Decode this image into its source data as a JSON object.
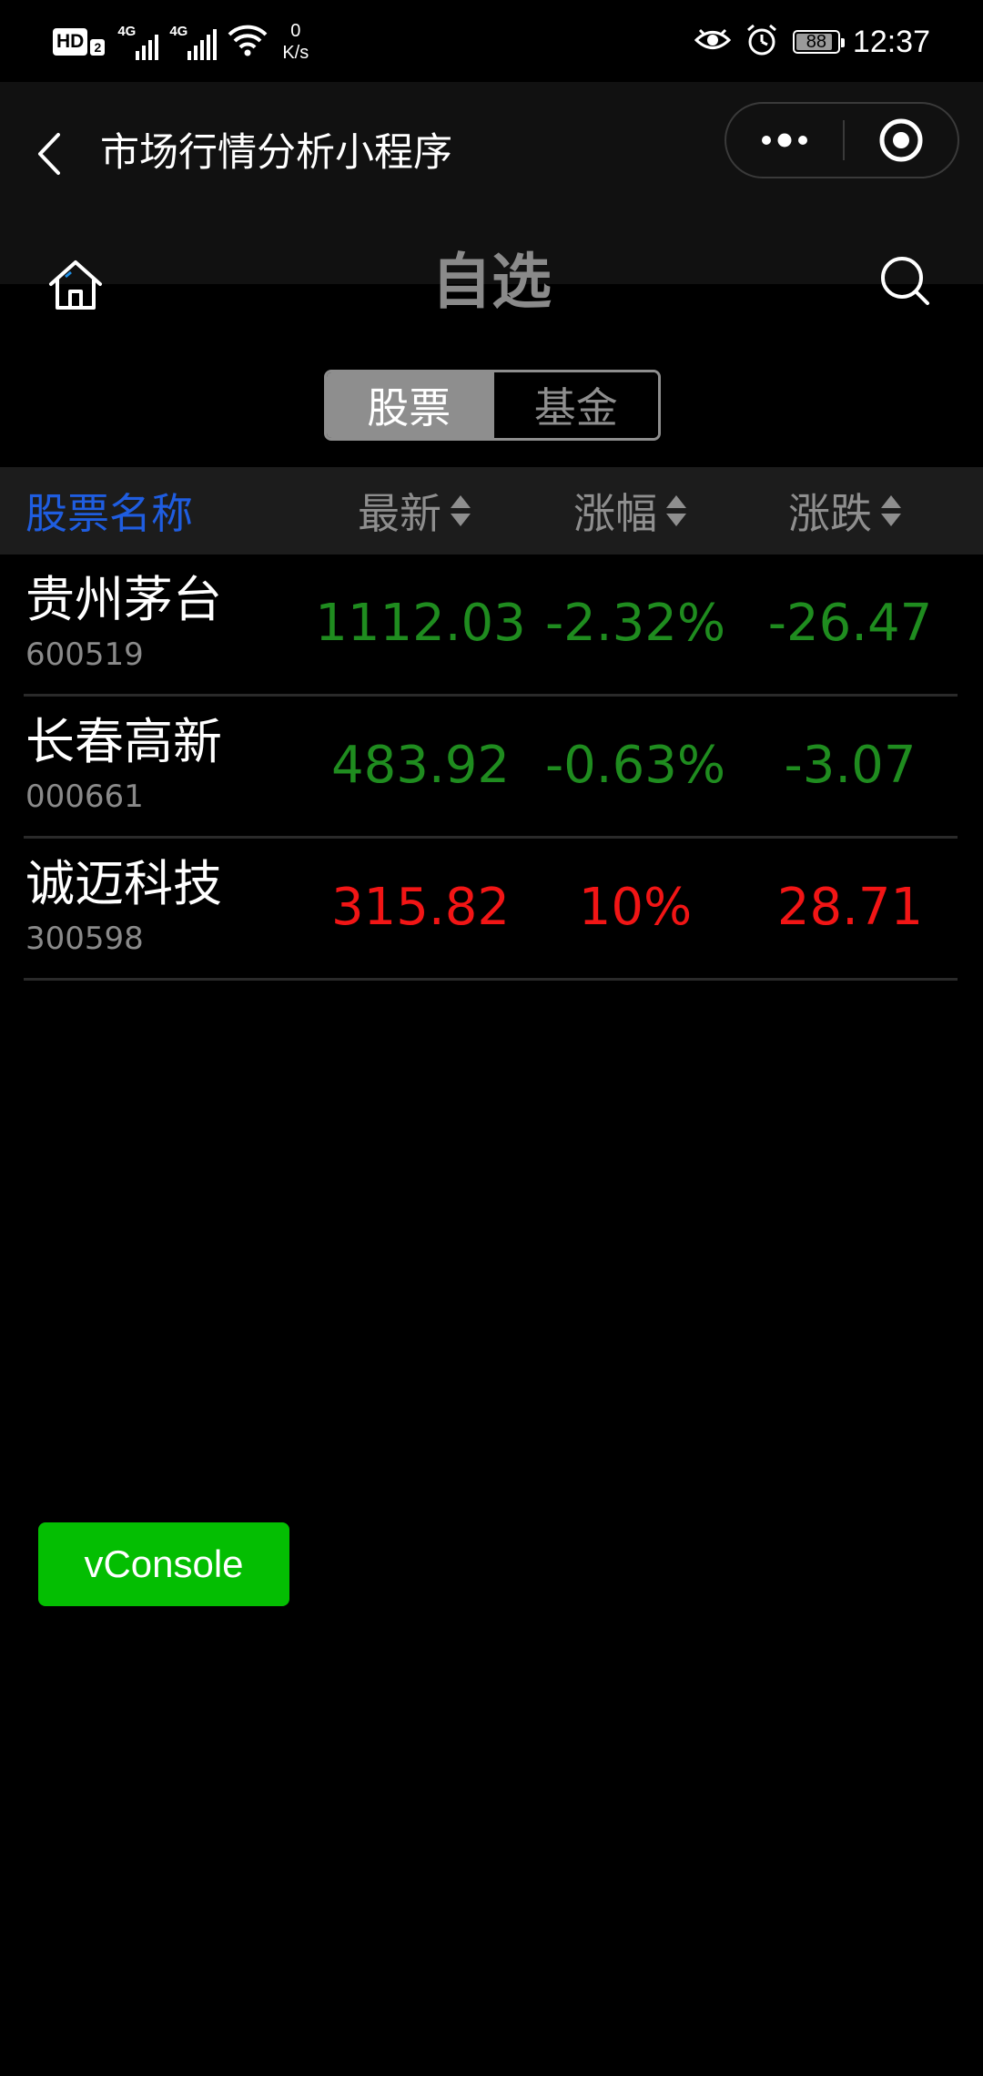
{
  "status_bar": {
    "hd_label": "HD",
    "hd_sub": "2",
    "network_label_1": "4G",
    "network_label_2": "4G",
    "net_speed_value": "0",
    "net_speed_unit": "K/s",
    "battery_level": "88",
    "battery_fraction": 0.88,
    "time": "12:37",
    "icons": [
      "wifi-icon",
      "eye-icon",
      "alarm-icon",
      "battery-icon"
    ]
  },
  "nav": {
    "app_title": "市场行情分析小程序",
    "page_title": "自选",
    "icons": [
      "back-icon",
      "more-icon",
      "close-target-icon",
      "home-icon",
      "search-icon"
    ]
  },
  "segment": {
    "tabs": [
      {
        "label": "股票",
        "active": true
      },
      {
        "label": "基金",
        "active": false
      }
    ]
  },
  "table": {
    "headers": {
      "name": "股票名称",
      "latest": "最新",
      "pct": "涨幅",
      "change": "涨跌"
    },
    "rows": [
      {
        "name": "贵州茅台",
        "code": "600519",
        "latest": "1112.03",
        "pct": "-2.32%",
        "change": "-26.47",
        "trend": "down"
      },
      {
        "name": "长春高新",
        "code": "000661",
        "latest": "483.92",
        "pct": "-0.63%",
        "change": "-3.07",
        "trend": "down"
      },
      {
        "name": "诚迈科技",
        "code": "300598",
        "latest": "315.82",
        "pct": "10%",
        "change": "28.71",
        "trend": "up"
      }
    ]
  },
  "colors": {
    "up": "#f21515",
    "down": "#1f8c1f",
    "header_name": "#1f5de0",
    "vconsole": "#04be02"
  },
  "vconsole_label": "vConsole"
}
